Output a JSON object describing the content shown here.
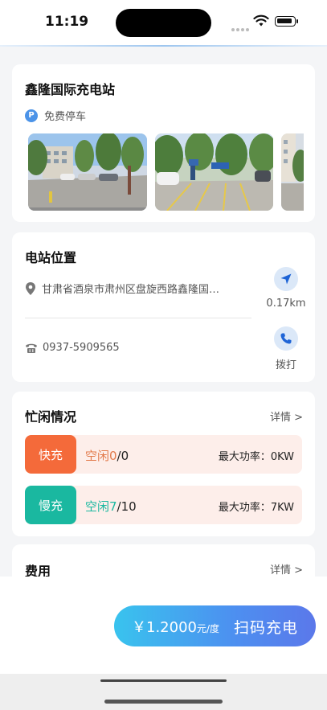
{
  "status_bar": {
    "time": "11:19"
  },
  "station": {
    "name": "鑫隆国际充电站",
    "parking_badge": "P",
    "parking_label": "免费停车",
    "photos": [
      "station-photo-parking-lot",
      "station-photo-charging-spots",
      "station-photo-building"
    ]
  },
  "location": {
    "title": "电站位置",
    "address": "甘肃省酒泉市肃州区盘旋西路鑫隆国…",
    "distance": "0.17km",
    "phone": "0937-5909565",
    "call_label": "拨打",
    "icons": {
      "pin": "location-pin-icon",
      "nav": "navigation-arrow-icon",
      "phone": "telephone-icon",
      "call": "phone-call-icon"
    }
  },
  "busy": {
    "title": "忙闲情况",
    "details_label": "详情 >",
    "rows": [
      {
        "type": "快充",
        "idle_label": "空闲0",
        "idle_total": "/0",
        "power": "最大功率：0KW",
        "color": "#f46a3a"
      },
      {
        "type": "慢充",
        "idle_label": "空闲7",
        "idle_total": "/10",
        "power": "最大功率：7KW",
        "color": "#1ab8a0"
      }
    ]
  },
  "fee": {
    "title": "费用",
    "details_label": "详情 >"
  },
  "action": {
    "price": "￥1.2000",
    "price_unit": "元/度",
    "scan_label": "扫码充电"
  },
  "colors": {
    "accent": "#4b93e8",
    "fast": "#f46a3a",
    "slow": "#1ab8a0",
    "row_bg": "#fdeeea"
  }
}
